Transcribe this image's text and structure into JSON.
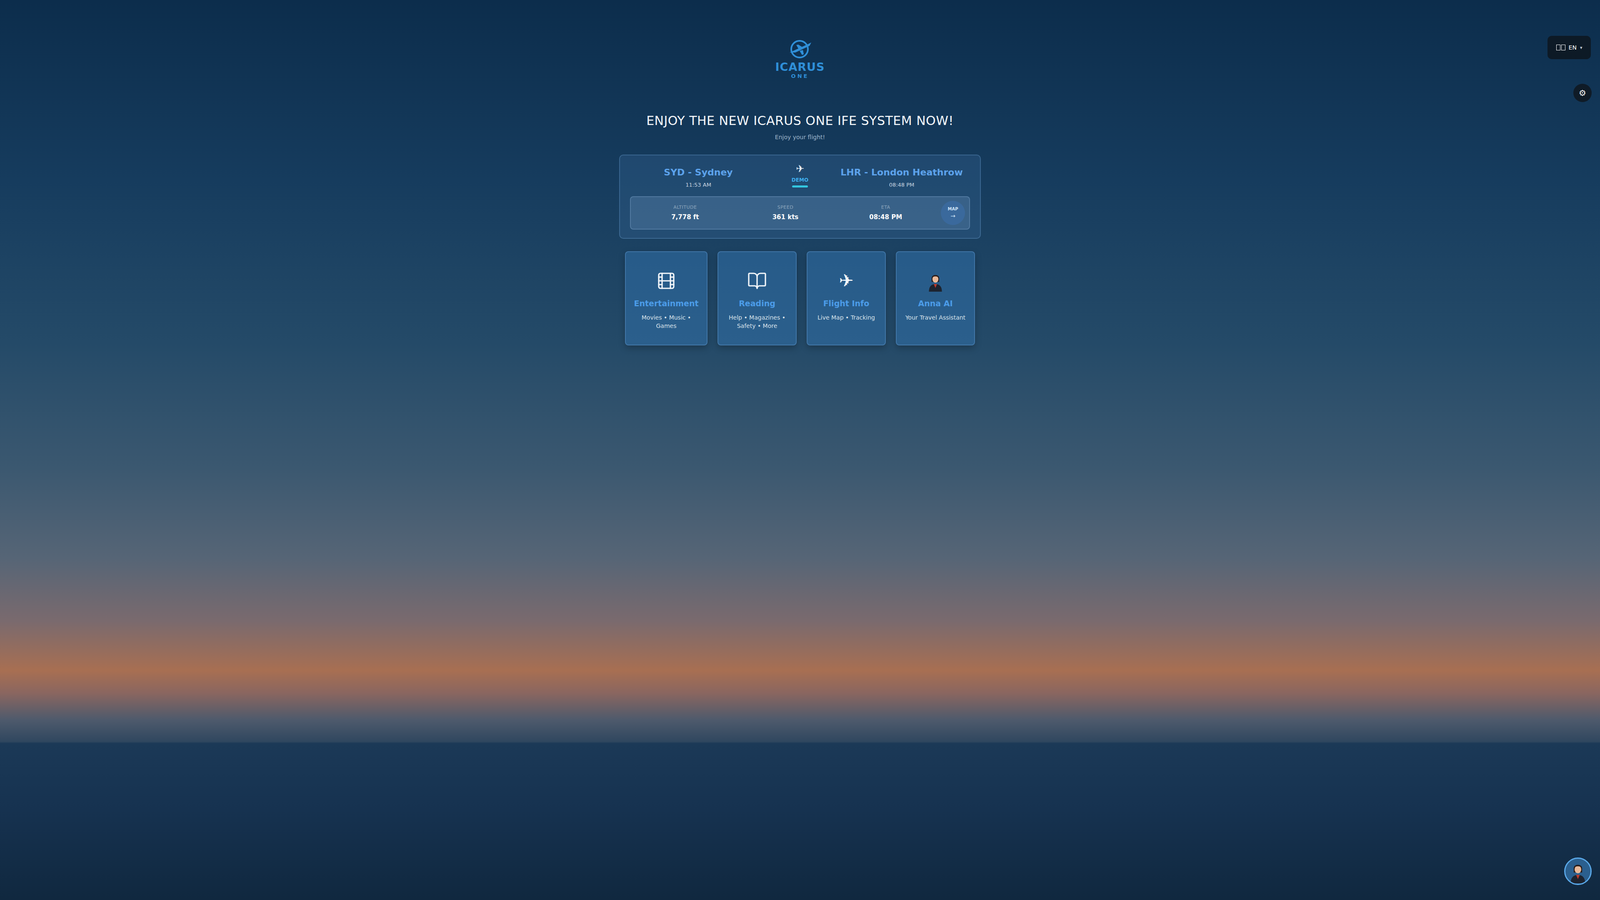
{
  "header": {
    "logo": {
      "name": "ICARUS",
      "sub": "ONE"
    },
    "language": {
      "label": "EN",
      "caret": "▾"
    },
    "settings": {
      "glyph": "⚙"
    }
  },
  "hero": {
    "title": "ENJOY THE NEW ICARUS ONE IFE SYSTEM NOW!",
    "subtitle": "Enjoy your flight!"
  },
  "flight": {
    "origin": {
      "name": "SYD - Sydney",
      "time": "11:53 AM"
    },
    "destination": {
      "name": "LHR - London Heathrow",
      "time": "08:48 PM"
    },
    "plane": "✈",
    "mode": "DEMO",
    "stats": [
      {
        "label": "ALTITUDE",
        "value": "7,778 ft"
      },
      {
        "label": "SPEED",
        "value": "361 kts"
      },
      {
        "label": "ETA",
        "value": "08:48 PM"
      }
    ],
    "map": {
      "label": "MAP",
      "arrow": "→"
    }
  },
  "tiles": [
    {
      "kind": "film",
      "title": "Entertainment",
      "description": "Movies • Music • Games"
    },
    {
      "kind": "book",
      "title": "Reading",
      "description": "Help • Magazines • Safety • More"
    },
    {
      "kind": "glyph",
      "glyph": "✈",
      "title": "Flight Info",
      "description": "Live Map • Tracking"
    },
    {
      "kind": "avatar",
      "title": "Anna AI",
      "description": "Your Travel Assistant"
    }
  ]
}
